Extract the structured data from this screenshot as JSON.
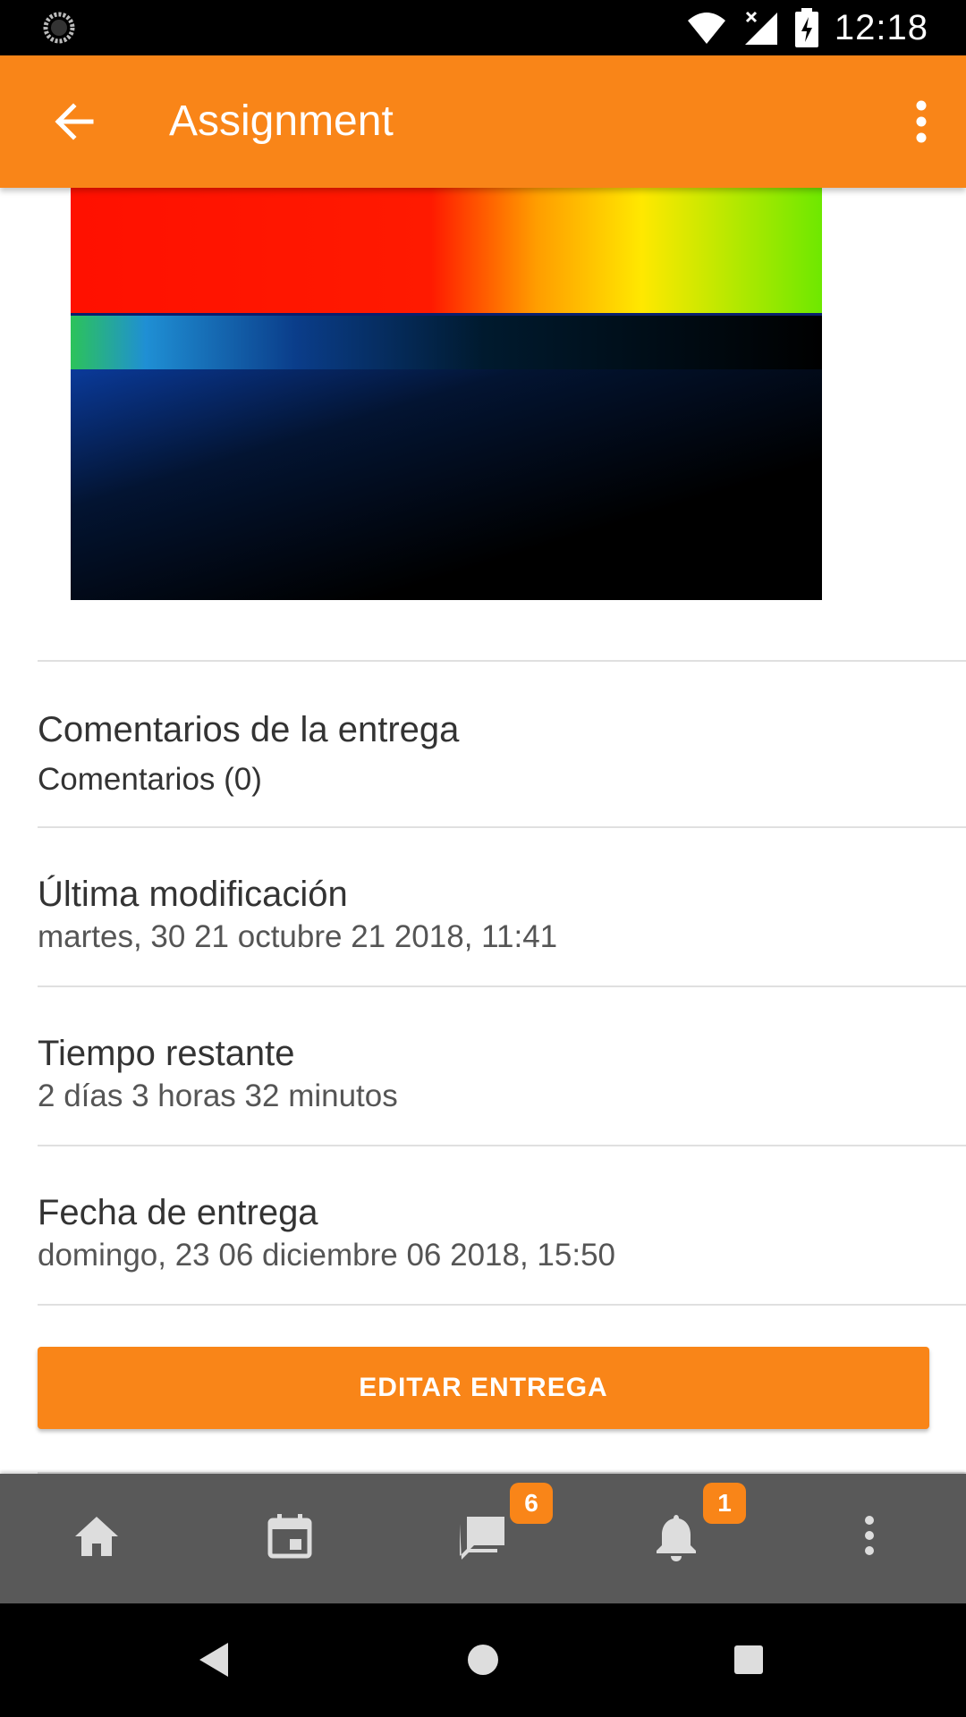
{
  "status_bar": {
    "time": "12:18",
    "icons": [
      "sync-icon",
      "wifi-icon",
      "signal-off-icon",
      "battery-charging-icon"
    ]
  },
  "app_bar": {
    "title": "Assignment",
    "back_icon": "arrow-back-icon",
    "menu_icon": "more-vert-icon"
  },
  "submission": {
    "image_alt": "spectrum image",
    "comments": {
      "title": "Comentarios de la entrega",
      "value": "Comentarios (0)"
    },
    "last_modified": {
      "title": "Última modificación",
      "value": "martes, 30 21 octubre 21 2018, 11:41"
    },
    "time_remaining": {
      "title": "Tiempo restante",
      "value": "2 días 3 horas 32 minutos"
    },
    "due_date": {
      "title": "Fecha de entrega",
      "value": "domingo, 23 06 diciembre 06 2018, 15:50"
    },
    "edit_button": "EDITAR ENTREGA"
  },
  "bottom_nav": {
    "items": [
      {
        "icon": "home-icon",
        "badge": ""
      },
      {
        "icon": "calendar-icon",
        "badge": ""
      },
      {
        "icon": "messages-icon",
        "badge": "6"
      },
      {
        "icon": "notifications-icon",
        "badge": "1"
      },
      {
        "icon": "more-vert-icon",
        "badge": ""
      }
    ]
  },
  "colors": {
    "accent": "#f98518",
    "bottom_nav_bg": "#595959",
    "divider": "#e0e0e0"
  }
}
